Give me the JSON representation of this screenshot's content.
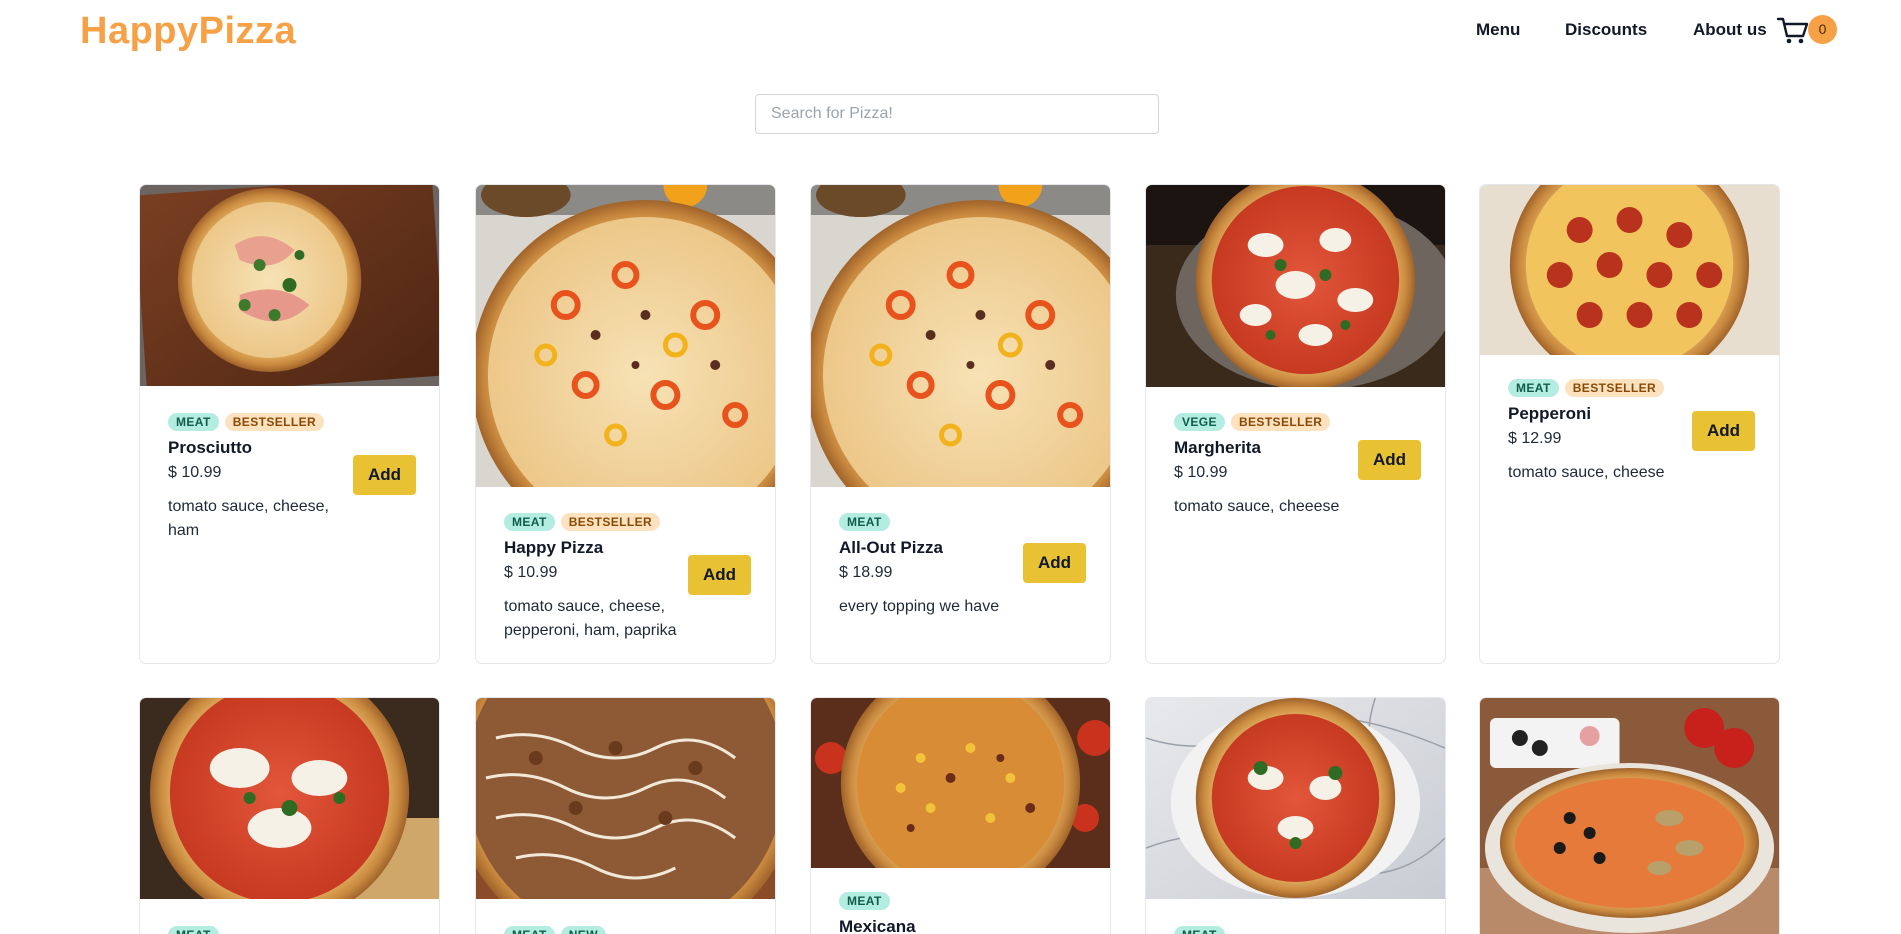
{
  "brand": {
    "logo": "HappyPizza",
    "accent": "#f7a147"
  },
  "nav": {
    "menu": "Menu",
    "discounts": "Discounts",
    "about": "About us"
  },
  "cart": {
    "count": "0"
  },
  "search": {
    "placeholder": "Search for Pizza!",
    "value": ""
  },
  "colors": {
    "tag_green": "#b3ece0",
    "tag_orange": "#fde2c0",
    "add_button": "#e8c232"
  },
  "pizzas": [
    {
      "name": "Prosciutto",
      "price": "$ 10.99",
      "ingredients": "tomato sauce, cheese, ham",
      "tags": [
        "MEAT",
        "BESTSELLER"
      ],
      "add_label": "Add"
    },
    {
      "name": "Happy Pizza",
      "price": "$ 10.99",
      "ingredients": "tomato sauce, cheese, pepperoni, ham, paprika",
      "tags": [
        "MEAT",
        "BESTSELLER"
      ],
      "add_label": "Add"
    },
    {
      "name": "All-Out Pizza",
      "price": "$ 18.99",
      "ingredients": "every topping we have",
      "tags": [
        "MEAT"
      ],
      "add_label": "Add"
    },
    {
      "name": "Margherita",
      "price": "$ 10.99",
      "ingredients": "tomato sauce, cheeese",
      "tags": [
        "VEGE",
        "BESTSELLER"
      ],
      "add_label": "Add"
    },
    {
      "name": "Pepperoni",
      "price": "$ 12.99",
      "ingredients": "tomato sauce, cheese",
      "tags": [
        "MEAT",
        "BESTSELLER"
      ],
      "add_label": "Add"
    },
    {
      "tags": [
        "MEAT"
      ]
    },
    {
      "tags": [
        "MEAT",
        "NEW"
      ]
    },
    {
      "name": "Mexicana",
      "tags": [
        "MEAT"
      ]
    },
    {
      "tags": [
        "MEAT"
      ]
    },
    {
      "tags": []
    }
  ]
}
